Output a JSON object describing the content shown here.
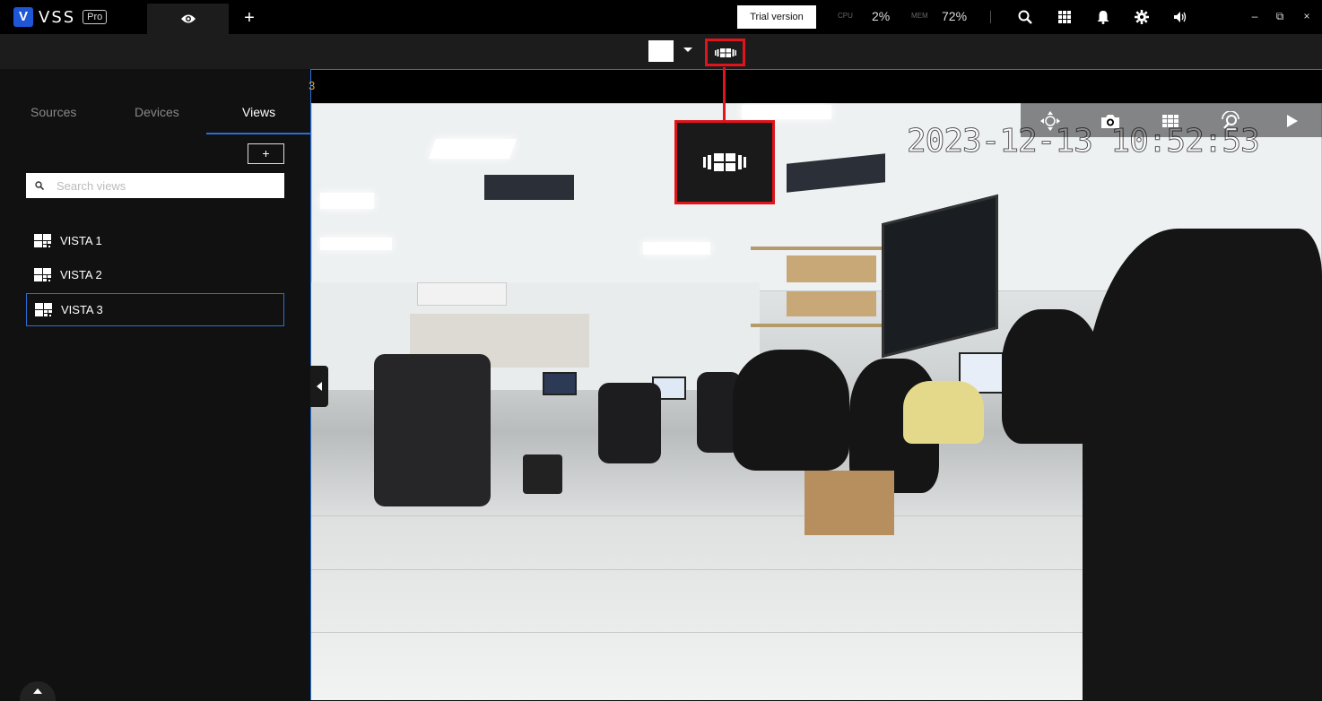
{
  "app": {
    "logo_letter": "V",
    "logo_text": "VSS",
    "logo_badge": "Pro",
    "trial_label": "Trial version",
    "cpu_label": "CPU",
    "cpu_value": "2%",
    "mem_label": "MEM",
    "mem_value": "72%"
  },
  "tabs": {
    "add_label": "+"
  },
  "sidebar": {
    "tabs": [
      {
        "label": "Sources"
      },
      {
        "label": "Devices"
      },
      {
        "label": "Views"
      }
    ],
    "add_view_label": "+",
    "search_placeholder": "Search views",
    "views": [
      {
        "label": "VISTA 1"
      },
      {
        "label": "VISTA 2"
      },
      {
        "label": "VISTA 3"
      }
    ],
    "selected_view": "VISTA 3"
  },
  "video": {
    "title_partial": "3",
    "timestamp": "2023-12-13 10:52:53"
  },
  "colors": {
    "accent_blue": "#2a6fd6",
    "highlight_red": "#e0141b",
    "logo_blue": "#1e56d6"
  },
  "icons": {
    "eye": "eye-icon",
    "search": "search-icon",
    "grid": "apps-grid-icon",
    "bell": "bell-icon",
    "settings": "gear-icon",
    "volume": "volume-icon",
    "fit": "fit-view-icon",
    "move": "move-icon",
    "snapshot": "camera-icon",
    "layout": "layout-grid-icon",
    "zoom": "digital-zoom-icon",
    "play": "play-icon"
  }
}
